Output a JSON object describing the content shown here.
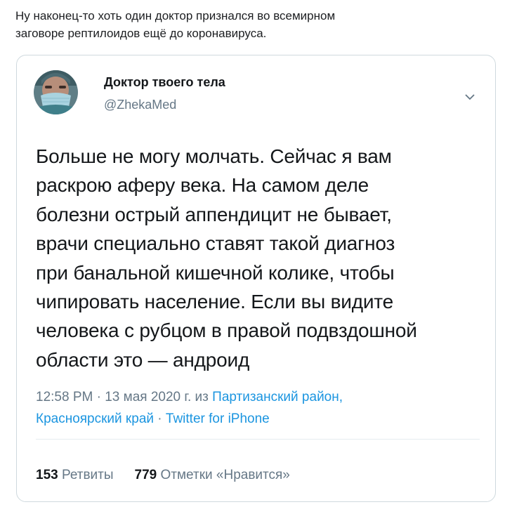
{
  "caption": {
    "lines": [
      "Ну наконец-то хоть один доктор признался во всемирном",
      "заговоре рептилоидов ещё до коронавируса."
    ]
  },
  "tweet": {
    "author_name": "Доктор твоего тела",
    "author_handle": "@ZhekaMed",
    "text_lines": [
      "Больше не могу молчать. Сейчас я вам",
      "раскрою аферу века. На самом деле",
      "болезни острый аппендицит не бывает,",
      "врачи специально ставят такой диагноз",
      "при банальной кишечной колике, чтобы",
      "чипировать население. Если вы видите",
      "человека с рубцом в правой подвздошной",
      "области это — андроид"
    ],
    "meta": {
      "time": "12:58 PM",
      "sep1": " · ",
      "date": "13 мая 2020 г.",
      "from_word": " из ",
      "location_line1": "Партизанский район,",
      "location_line2": "Красноярский край",
      "sep2": " · ",
      "source": "Twitter for iPhone"
    },
    "stats": {
      "retweets_count": "153",
      "retweets_label": "Ретвиты",
      "likes_count": "779",
      "likes_label": "Отметки «Нравится»"
    },
    "icons": {
      "menu": "chevron-down-icon"
    },
    "colors": {
      "link": "#1b95e0",
      "secondary": "#657786",
      "primary": "#14171a"
    }
  }
}
